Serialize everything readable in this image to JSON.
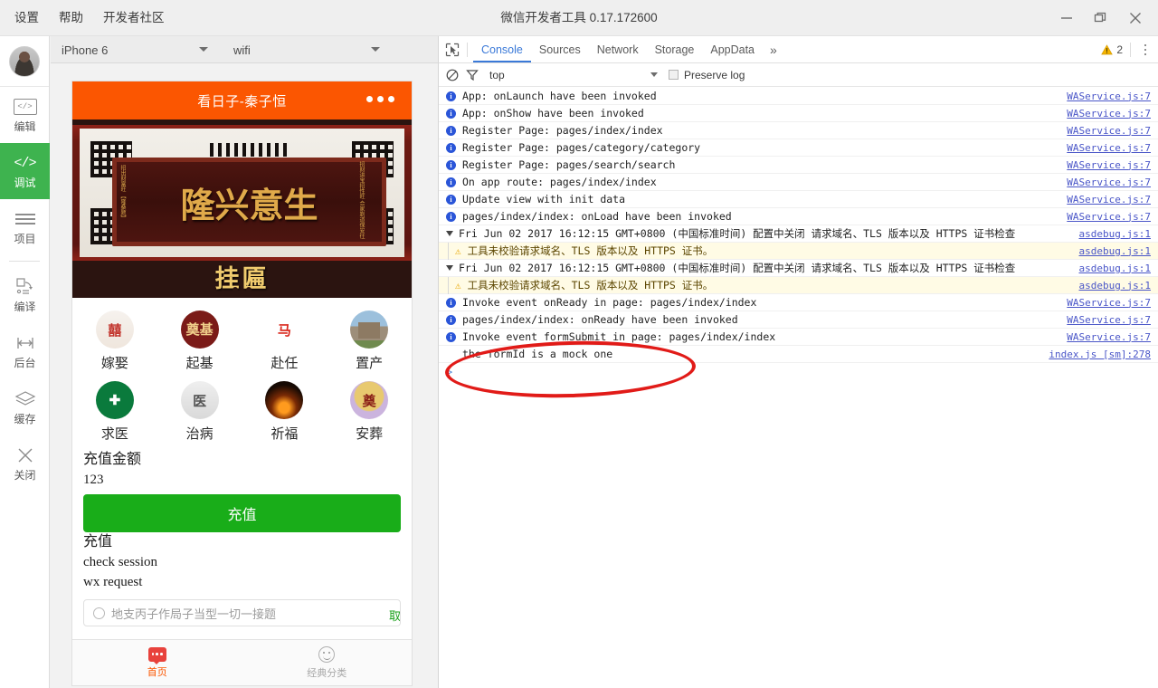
{
  "window": {
    "title": "微信开发者工具 0.17.172600",
    "menu": [
      "设置",
      "帮助",
      "开发者社区"
    ],
    "controls": [
      "minimize-icon",
      "restore-icon",
      "close-icon"
    ]
  },
  "rail": {
    "avatar": "user-avatar",
    "items": [
      {
        "label": "编辑",
        "icon": "code-box-icon",
        "active": false
      },
      {
        "label": "调试",
        "icon": "code-brackets-icon",
        "active": true
      },
      {
        "label": "项目",
        "icon": "hamburger-icon",
        "active": false
      },
      {
        "label": "编译",
        "icon": "compile-icon",
        "active": false
      },
      {
        "label": "后台",
        "icon": "background-icon",
        "active": false
      },
      {
        "label": "缓存",
        "icon": "layers-icon",
        "active": false
      },
      {
        "label": "关闭",
        "icon": "close-x-icon",
        "active": false
      }
    ]
  },
  "simulator": {
    "device": "iPhone 6",
    "network": "wifi",
    "phone": {
      "nav_title": "看日子-秦子恒",
      "banner": {
        "plaque_text": "隆兴意生",
        "side_left": "招出财富旺\n【隆桑题】",
        "side_right": "招财进宝招性旺\n合家剃道保安往",
        "caption": "挂匾"
      },
      "grid": [
        {
          "label": "嫁娶",
          "icon": "wedding-couple-icon"
        },
        {
          "label": "起基",
          "icon": "foundation-seal-icon"
        },
        {
          "label": "赴任",
          "icon": "appointment-seal-icon"
        },
        {
          "label": "置产",
          "icon": "property-house-icon"
        },
        {
          "label": "求医",
          "icon": "medical-cross-icon"
        },
        {
          "label": "治病",
          "icon": "healer-portrait-icon"
        },
        {
          "label": "祈福",
          "icon": "prayer-candles-icon"
        },
        {
          "label": "安葬",
          "icon": "burial-seal-icon"
        }
      ],
      "form": {
        "amount_label": "充值金额",
        "amount_value": "123",
        "submit_label": "充值",
        "lines": [
          "充值",
          "check session",
          "wx request"
        ]
      },
      "search": {
        "placeholder": "地支丙子作局子当型一切一接题",
        "cancel_label": "取消"
      },
      "tabbar": [
        {
          "label": "首页",
          "icon": "home-bubble-icon",
          "active": true
        },
        {
          "label": "经典分类",
          "icon": "smiley-category-icon",
          "active": false
        }
      ]
    }
  },
  "devtools": {
    "inspect_icon": "inspect-cursor-icon",
    "tabs": [
      "Console",
      "Sources",
      "Network",
      "Storage",
      "AppData"
    ],
    "selected_tab": "Console",
    "more_tabs": "»",
    "warning_icon": "warning-triangle-icon",
    "warning_count": "2",
    "menu_icon": "vertical-dots-icon",
    "filter": {
      "clear_icon": "clear-console-icon",
      "filter_icon": "funnel-icon",
      "context": "top",
      "preserve_log_label": "Preserve log",
      "preserve_log_checked": false
    },
    "logs": [
      {
        "kind": "info",
        "text": "App: onLaunch have been invoked",
        "source": "WAService.js:7"
      },
      {
        "kind": "info",
        "text": "App: onShow have been invoked",
        "source": "WAService.js:7"
      },
      {
        "kind": "info",
        "text": "Register Page: pages/index/index",
        "source": "WAService.js:7"
      },
      {
        "kind": "info",
        "text": "Register Page: pages/category/category",
        "source": "WAService.js:7"
      },
      {
        "kind": "info",
        "text": "Register Page: pages/search/search",
        "source": "WAService.js:7"
      },
      {
        "kind": "info",
        "text": "On app route: pages/index/index",
        "source": "WAService.js:7"
      },
      {
        "kind": "info",
        "text": "Update view with init data",
        "source": "WAService.js:7"
      },
      {
        "kind": "info",
        "text": "pages/index/index: onLoad have been invoked",
        "source": "WAService.js:7"
      },
      {
        "kind": "group",
        "text": "Fri Jun 02 2017 16:12:15 GMT+0800 (中国标准时间) 配置中关闭 请求域名、TLS 版本以及 HTTPS 证书检查",
        "source": "asdebug.js:1"
      },
      {
        "kind": "warn",
        "text": "工具未校验请求域名、TLS 版本以及 HTTPS 证书。",
        "source": "asdebug.js:1"
      },
      {
        "kind": "group",
        "text": "Fri Jun 02 2017 16:12:15 GMT+0800 (中国标准时间) 配置中关闭 请求域名、TLS 版本以及 HTTPS 证书检查",
        "source": "asdebug.js:1"
      },
      {
        "kind": "warn",
        "text": "工具未校验请求域名、TLS 版本以及 HTTPS 证书。",
        "source": "asdebug.js:1"
      },
      {
        "kind": "info",
        "text": "Invoke event onReady in page: pages/index/index",
        "source": "WAService.js:7"
      },
      {
        "kind": "info",
        "text": "pages/index/index: onReady have been invoked",
        "source": "WAService.js:7"
      },
      {
        "kind": "info",
        "text": "Invoke event formSubmit in page: pages/index/index",
        "source": "WAService.js:7"
      },
      {
        "kind": "plain",
        "text": "the formId is a mock one",
        "source": "index.js [sm]:278"
      }
    ],
    "prompt": ">"
  },
  "annotation": {
    "shape": "ellipse",
    "color": "#e11b18"
  },
  "colors": {
    "accent_green": "#3eb34f",
    "wechat_orange": "#fb5601",
    "button_green": "#19ad19",
    "link_blue": "#4a56c8",
    "tab_blue": "#3a79d8",
    "warn_bg": "#fffbe5"
  }
}
